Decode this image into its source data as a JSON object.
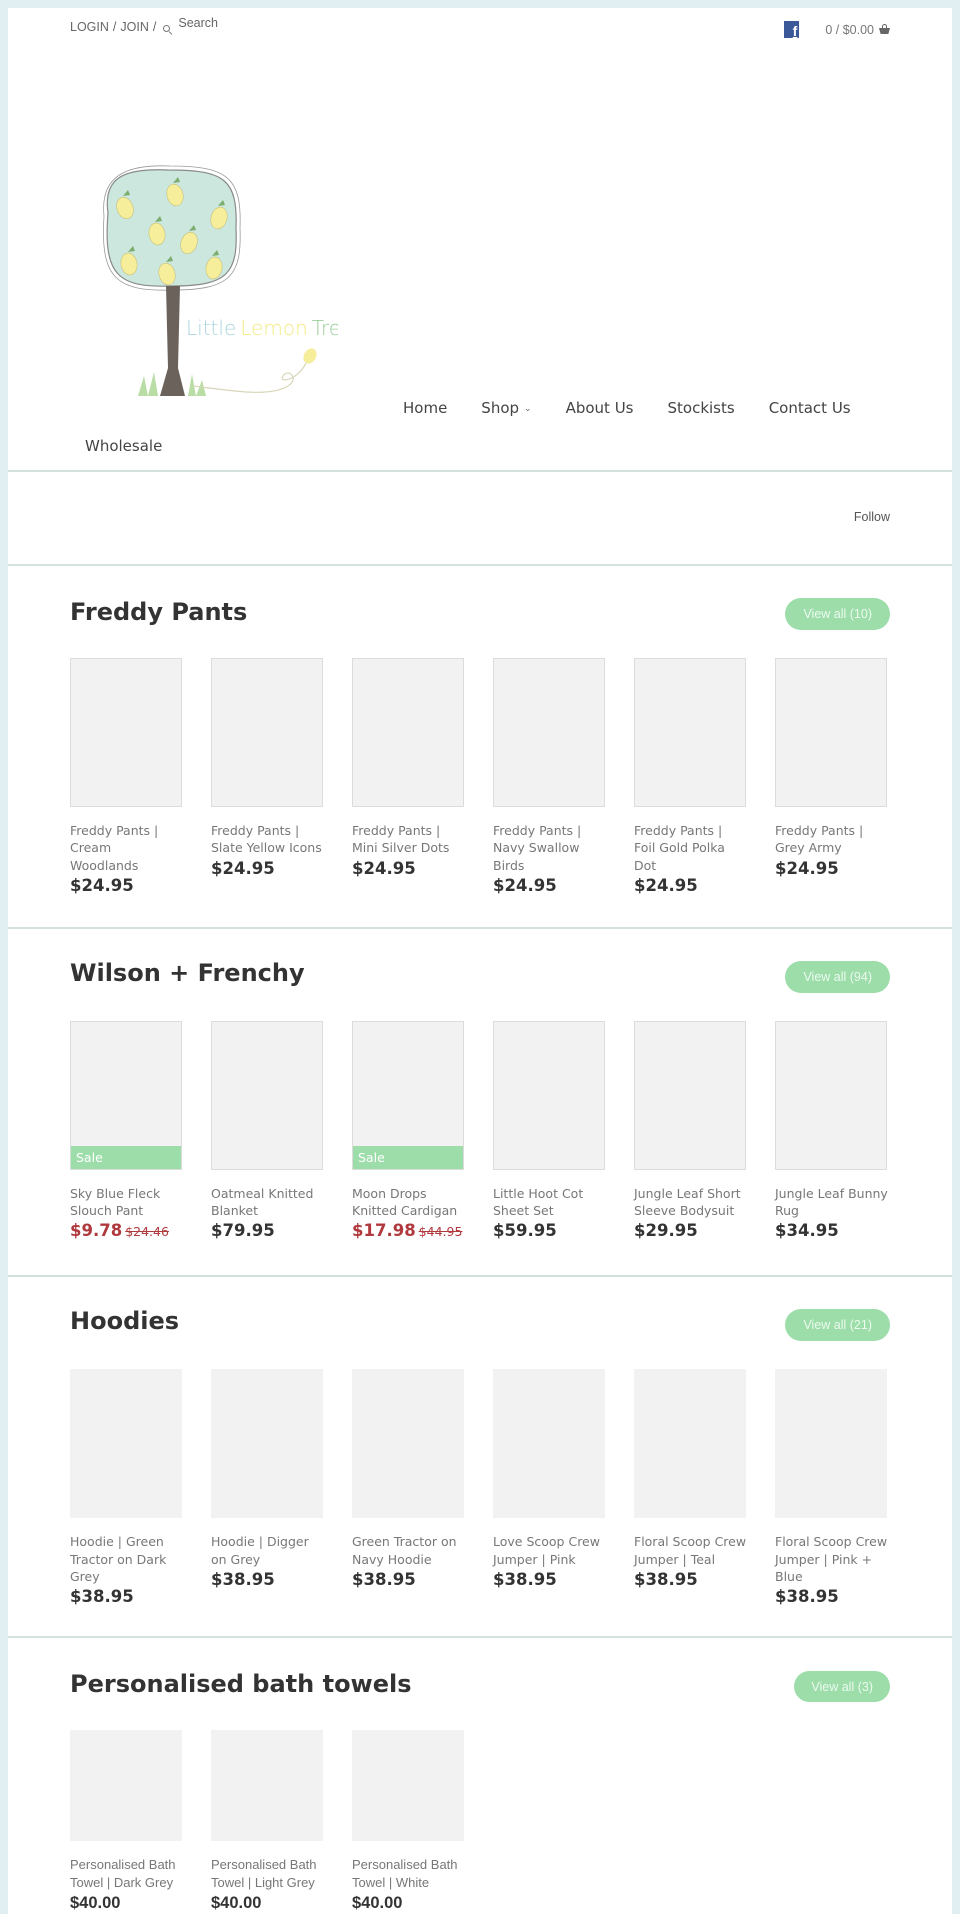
{
  "topbar": {
    "login_label": "LOGIN",
    "join_label": "JOIN",
    "separator": "/",
    "search_placeholder": "Search",
    "cart_label": "0 / $0.00"
  },
  "brand": {
    "name": "Little Lemon Tree",
    "name_parts": [
      "Little",
      "Lemon",
      "Tree"
    ]
  },
  "nav": {
    "items": [
      {
        "label": "Home"
      },
      {
        "label": "Shop",
        "chevron": "⌄"
      },
      {
        "label": "About Us"
      },
      {
        "label": "Stockists"
      },
      {
        "label": "Contact Us"
      }
    ],
    "wholesale_label": "Wholesale"
  },
  "follow_label": "Follow",
  "colors": {
    "accent_green": "#9dddaa",
    "sale_red": "#b0393d",
    "facebook_blue": "#3b5998",
    "page_bg": "#e1eef2"
  },
  "collections": [
    {
      "title": "Freddy Pants",
      "view_all_label": "View all (10)",
      "products": [
        {
          "name": "Freddy Pants | Cream Woodlands",
          "price": "$24.95"
        },
        {
          "name": "Freddy Pants | Slate Yellow Icons",
          "price": "$24.95"
        },
        {
          "name": "Freddy Pants | Mini Silver Dots",
          "price": "$24.95"
        },
        {
          "name": "Freddy Pants | Navy Swallow Birds",
          "price": "$24.95"
        },
        {
          "name": "Freddy Pants | Foil Gold Polka Dot",
          "price": "$24.95"
        },
        {
          "name": "Freddy Pants | Grey Army",
          "price": "$24.95"
        }
      ]
    },
    {
      "title": "Wilson + Frenchy",
      "view_all_label": "View all (94)",
      "sale_badge_label": "Sale",
      "products": [
        {
          "name": "Sky Blue Fleck Slouch Pant",
          "price": "$9.78",
          "was_price": "$24.46",
          "on_sale": true
        },
        {
          "name": "Oatmeal Knitted Blanket",
          "price": "$79.95"
        },
        {
          "name": "Moon Drops Knitted Cardigan",
          "price": "$17.98",
          "was_price": "$44.95",
          "on_sale": true
        },
        {
          "name": "Little Hoot Cot Sheet Set",
          "price": "$59.95"
        },
        {
          "name": "Jungle Leaf Short Sleeve Bodysuit",
          "price": "$29.95"
        },
        {
          "name": "Jungle Leaf Bunny Rug",
          "price": "$34.95"
        }
      ]
    },
    {
      "title": "Hoodies",
      "view_all_label": "View all (21)",
      "products": [
        {
          "name": "Hoodie | Green Tractor on Dark Grey",
          "price": "$38.95"
        },
        {
          "name": "Hoodie | Digger on Grey",
          "price": "$38.95"
        },
        {
          "name": "Green Tractor on Navy Hoodie",
          "price": "$38.95"
        },
        {
          "name": "Love Scoop Crew Jumper | Pink",
          "price": "$38.95"
        },
        {
          "name": "Floral Scoop Crew Jumper | Teal",
          "price": "$38.95"
        },
        {
          "name": "Floral Scoop Crew Jumper | Pink + Blue",
          "price": "$38.95"
        }
      ]
    },
    {
      "title": "Personalised bath towels",
      "view_all_label": "View all (3)",
      "products": [
        {
          "name": "Personalised Bath Towel | Dark Grey",
          "price": "$40.00"
        },
        {
          "name": "Personalised Bath Towel | Light Grey",
          "price": "$40.00"
        },
        {
          "name": "Personalised Bath Towel | White",
          "price": "$40.00"
        }
      ]
    }
  ]
}
